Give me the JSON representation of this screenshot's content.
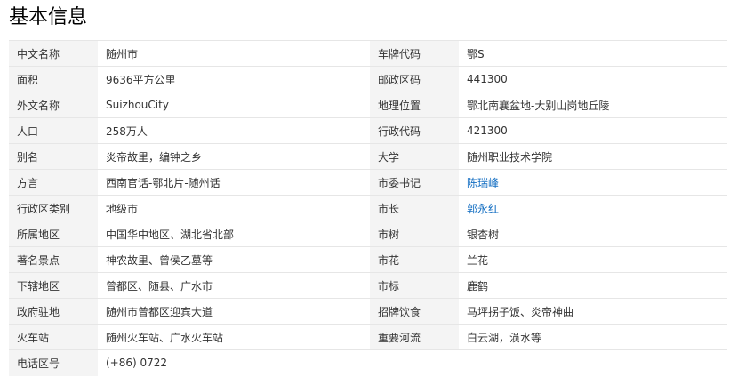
{
  "section": {
    "title": "基本信息"
  },
  "colors": {
    "label_bg": "#f4f4f4",
    "link": "#136ec2",
    "border": "#e6e6e6"
  },
  "rows": [
    {
      "k1": "中文名称",
      "v1": "随州市",
      "k2": "车牌代码",
      "v2": "鄂S"
    },
    {
      "k1": "面积",
      "v1": "9636平方公里",
      "k2": "邮政区码",
      "v2": "441300"
    },
    {
      "k1": "外文名称",
      "v1": "SuizhouCity",
      "k2": "地理位置",
      "v2": "鄂北南襄盆地-大别山岗地丘陵"
    },
    {
      "k1": "人口",
      "v1": "258万人",
      "k2": "行政代码",
      "v2": "421300"
    },
    {
      "k1": "别名",
      "v1": "炎帝故里，编钟之乡",
      "k2": "大学",
      "v2": "随州职业技术学院"
    },
    {
      "k1": "方言",
      "v1": "西南官话-鄂北片-随州话",
      "k2": "市委书记",
      "v2": "陈瑞峰"
    },
    {
      "k1": "行政区类别",
      "v1": "地级市",
      "k2": "市长",
      "v2": "郭永红"
    },
    {
      "k1": "所属地区",
      "v1": "中国华中地区、湖北省北部",
      "k2": "市树",
      "v2": "银杏树"
    },
    {
      "k1": "著名景点",
      "v1": "神农故里、曾侯乙墓等",
      "k2": "市花",
      "v2": "兰花"
    },
    {
      "k1": "下辖地区",
      "v1": "曾都区、随县、广水市",
      "k2": "市标",
      "v2": "鹿鹤"
    },
    {
      "k1": "政府驻地",
      "v1": "随州市曾都区迎宾大道",
      "k2": "招牌饮食",
      "v2": "马坪拐子饭、炎帝神曲"
    },
    {
      "k1": "火车站",
      "v1": "随州火车站、广水火车站",
      "k2": "重要河流",
      "v2": "白云湖，涢水等"
    },
    {
      "k1": "电话区号",
      "v1": "(+86) 0722",
      "k2": "",
      "v2": ""
    }
  ]
}
